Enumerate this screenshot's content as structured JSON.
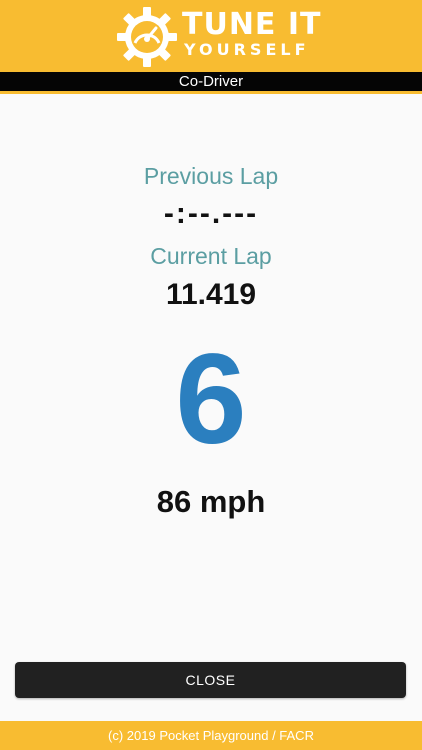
{
  "header": {
    "brand_line1": "TUNE IT",
    "brand_line2": "YOURSELF",
    "logo_icon": "gear-speedometer-icon",
    "background_color": "#f8bc31"
  },
  "subtitle": {
    "text": "Co-Driver"
  },
  "laps": {
    "previous_label": "Previous Lap",
    "previous_value": "-:--.---",
    "current_label": "Current Lap",
    "current_value": "11.419"
  },
  "gear": {
    "value": "6",
    "color": "#2b7fbf"
  },
  "speed": {
    "text": "86 mph"
  },
  "close_button": {
    "label": "CLOSE"
  },
  "footer": {
    "text": "(c) 2019 Pocket Playground / FACR"
  },
  "colors": {
    "accent": "#f8bc31",
    "label_teal": "#5b9ea2",
    "button_dark": "#212121"
  }
}
